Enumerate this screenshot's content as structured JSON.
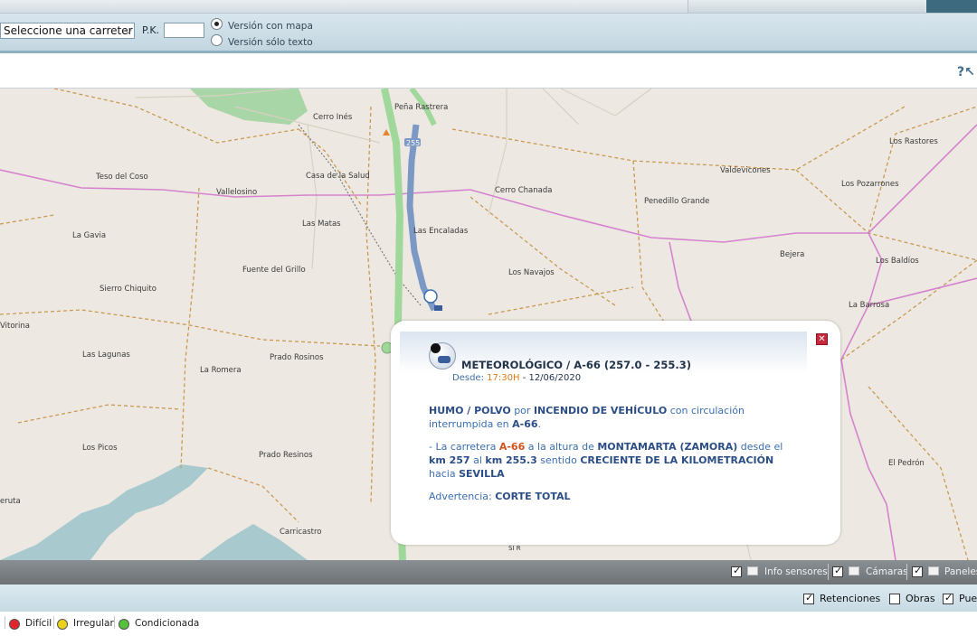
{
  "toolbar": {
    "road_select": "Seleccione una carreter",
    "pk_label": "P.K.",
    "pk_value": "",
    "radio_map_label": "Versión con mapa",
    "radio_text_label": "Versión sólo texto",
    "selected_version": "map"
  },
  "map": {
    "places": [
      "Cerro Inés",
      "Peña Rastrera",
      "Teso del Coso",
      "Vallelosino",
      "Casa de la Salud",
      "Cerro Chanada",
      "Valdevicones",
      "Los Rastores",
      "Los Pozarrones",
      "Penedillo Grande",
      "La Gavia",
      "Las Matas",
      "Las Encaladas",
      "Fuente del Grillo",
      "Los Navajos",
      "Bejera",
      "Los Baldíos",
      "Sierro Chiquito",
      "Vitorina",
      "La Barrosa",
      "Las Lagunas",
      "Prado Rosinos",
      "La Romera",
      "Los Picos",
      "Prado Resinos",
      "El Pedrón",
      "eruta",
      "Carricastro"
    ],
    "road_shield": "255",
    "road_label_bottom": "SI R"
  },
  "popup": {
    "title": "METEOROLÓGICO / A-66 (257.0 - 255.3)",
    "date_prefix": "Desde:",
    "time": "17:30H",
    "date_sep": "-",
    "date": "12/06/2020",
    "p1_a": "HUMO / POLVO",
    "p1_b": " por ",
    "p1_c": "INCENDIO DE VEHÍCULO",
    "p1_d": " con circulación interrumpida en ",
    "p1_e": "A-66",
    "p1_f": ".",
    "p2_a": "- La carretera ",
    "p2_road": "A-66",
    "p2_b": " a la altura de ",
    "p2_c": "MONTAMARTA (ZAMORA)",
    "p2_d": " desde el ",
    "p2_e": "km 257",
    "p2_f": " al ",
    "p2_g": "km 255.3",
    "p2_h": " sentido ",
    "p2_i": "CRECIENTE DE LA KILOMETRACIÓN",
    "p2_j": " hacia ",
    "p2_k": "SEVILLA",
    "p3_a": "Advertencia: ",
    "p3_b": "CORTE TOTAL",
    "close": "✕"
  },
  "grey_bar": {
    "sensors": "Info sensores",
    "cameras": "Cámaras",
    "panels": "Paneles"
  },
  "blue_bar": {
    "retenciones": "Retenciones",
    "obras": "Obras",
    "puertos": "Pue"
  },
  "legend": {
    "dificil": "Difícil",
    "irregular": "Irregular",
    "condicionada": "Condicionada",
    "colors": {
      "dificil": "#e0262c",
      "irregular": "#e8d21c",
      "condicionada": "#55c23a"
    }
  }
}
